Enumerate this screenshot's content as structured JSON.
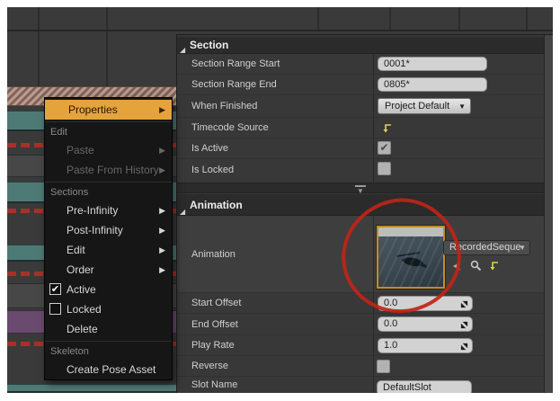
{
  "glyphs": {
    "submenu_arrow": "▶",
    "dropdown_arrow": "▼",
    "check": "✔",
    "header_expander": "◢",
    "collapse_arrow": "▼"
  },
  "colors": {
    "accent_yellow": "#E5A33C",
    "teal_track": "#4E7A76",
    "purple_track": "#6A4A6E",
    "red_dash": "#A83028",
    "annotation_red": "#BF2418",
    "thumbnail_border": "#C08C2A",
    "reset_icon_yellow": "#D9D94E"
  },
  "context_menu": {
    "properties_item": {
      "label": "Properties"
    },
    "groups": [
      {
        "label": "Edit",
        "items": [
          {
            "label": "Paste",
            "disabled": true,
            "submenu": true
          },
          {
            "label": "Paste From History",
            "disabled": true,
            "submenu": true
          }
        ]
      },
      {
        "label": "Sections",
        "items": [
          {
            "label": "Pre-Infinity",
            "submenu": true
          },
          {
            "label": "Post-Infinity",
            "submenu": true
          },
          {
            "label": "Edit",
            "submenu": true
          },
          {
            "label": "Order",
            "submenu": true
          },
          {
            "label": "Active",
            "checked": true
          },
          {
            "label": "Locked",
            "checked": false
          },
          {
            "label": "Delete"
          }
        ]
      },
      {
        "label": "Skeleton",
        "items": [
          {
            "label": "Create Pose Asset"
          }
        ]
      }
    ]
  },
  "details_panel": {
    "section": {
      "title": "Section",
      "range_start_label": "Section Range Start",
      "range_start_value": "0001*",
      "range_end_label": "Section Range End",
      "range_end_value": "0805*",
      "when_finished_label": "When Finished",
      "when_finished_value": "Project Default",
      "timecode_label": "Timecode Source",
      "is_active_label": "Is Active",
      "is_locked_label": "Is Locked"
    },
    "animation": {
      "title": "Animation",
      "animation_label": "Animation",
      "asset_value": "RecordedSeque",
      "start_offset_label": "Start Offset",
      "start_offset_value": "0.0",
      "end_offset_label": "End Offset",
      "end_offset_value": "0.0",
      "play_rate_label": "Play Rate",
      "play_rate_value": "1.0",
      "reverse_label": "Reverse",
      "slot_name_label": "Slot Name",
      "slot_name_value": "DefaultSlot"
    }
  }
}
